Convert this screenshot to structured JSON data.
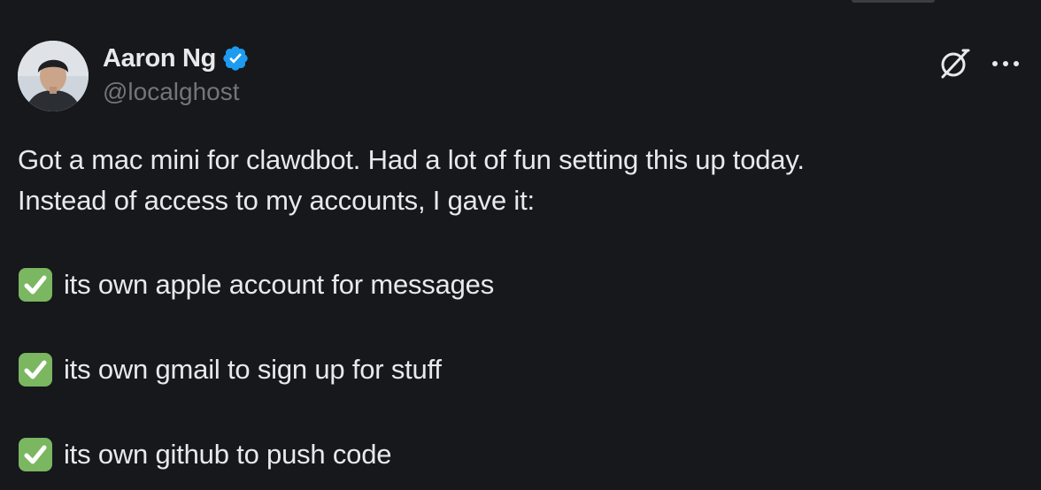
{
  "author": {
    "display_name": "Aaron Ng",
    "handle": "@localghost",
    "verified": true
  },
  "icons": {
    "avatar": "avatar-photo",
    "verified": "verified-badge-icon",
    "grok": "grok-icon",
    "more": "more-options-icon",
    "check": "check-mark-emoji"
  },
  "colors": {
    "background": "#16181c",
    "text": "#e7e9ea",
    "muted": "#71767b",
    "verified_blue": "#1d9bf0",
    "check_green": "#7bb661"
  },
  "tweet": {
    "line1": "Got a mac mini for clawdbot. Had a lot of fun setting this up today.",
    "line2": "Instead of access to my accounts, I gave it:",
    "items": [
      "its own apple account for messages",
      "its own gmail to sign up for stuff",
      "its own github to push code"
    ]
  }
}
